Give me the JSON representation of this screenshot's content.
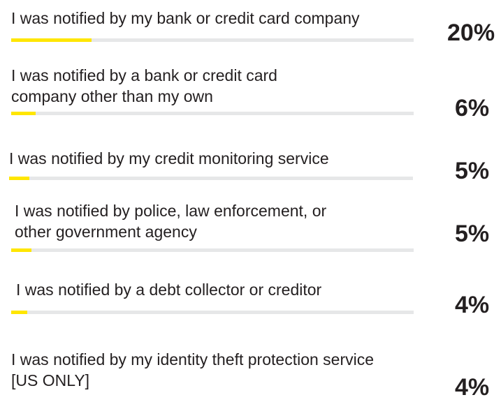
{
  "chart_data": {
    "type": "bar",
    "orientation": "horizontal",
    "categories": [
      "I was notified by my bank or credit card company",
      "I was notified by a bank or credit card\ncompany other than my own",
      "I was notified by my credit monitoring service",
      "I was notified by police, law enforcement, or\nother government agency",
      "I was notified by a debt collector or creditor",
      "I was notified by my identity theft protection service\n[US ONLY]"
    ],
    "values": [
      20,
      6,
      5,
      5,
      4,
      4
    ],
    "value_labels": [
      "20%",
      "6%",
      "5%",
      "5%",
      "4%",
      "4%"
    ],
    "xlim": [
      0,
      100
    ],
    "bar_color": "#ffe600",
    "track_color": "#e6e7e8",
    "grid": false,
    "legend": "none"
  }
}
